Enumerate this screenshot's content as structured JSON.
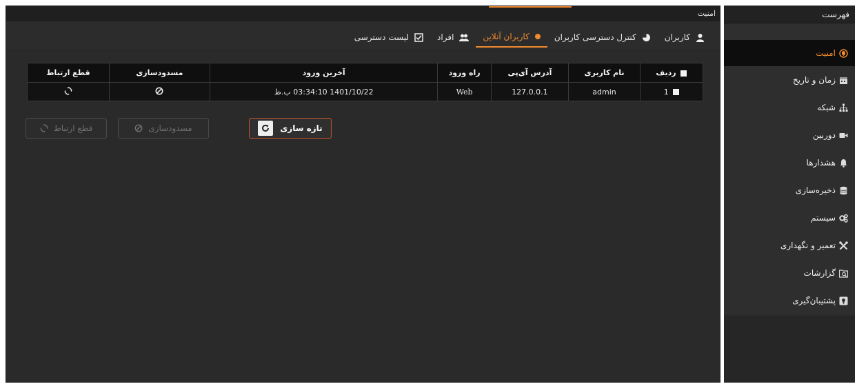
{
  "sidebar": {
    "title": "فهرست",
    "items": [
      {
        "label": "امنیت",
        "icon": "shield-icon",
        "active": true
      },
      {
        "label": "زمان و تاریخ",
        "icon": "calendar-icon"
      },
      {
        "label": "شبکه",
        "icon": "network-icon"
      },
      {
        "label": "دوربین",
        "icon": "camera-icon"
      },
      {
        "label": "هشدارها",
        "icon": "bell-icon"
      },
      {
        "label": "ذخیره‌سازی",
        "icon": "database-icon"
      },
      {
        "label": "سیستم",
        "icon": "gears-icon"
      },
      {
        "label": "تعمیر و نگهداری",
        "icon": "tools-icon"
      },
      {
        "label": "گزارشات",
        "icon": "report-search-icon"
      },
      {
        "label": "پشتیبان‌گیری",
        "icon": "backup-icon"
      }
    ]
  },
  "main": {
    "title": "امنیت",
    "tabs": [
      {
        "label": "کاربران",
        "icon": "user-icon"
      },
      {
        "label": "کنترل دسترسی کاربران",
        "icon": "pie-icon"
      },
      {
        "label": "کاربران آنلاین",
        "icon": "dot-icon",
        "active": true
      },
      {
        "label": "افراد",
        "icon": "people-icon"
      },
      {
        "label": "لیست دسترسی",
        "icon": "checklist-icon"
      }
    ]
  },
  "table": {
    "headers": {
      "row": "ردیف",
      "username": "نام کاربری",
      "ip": "آدرس آی‌پی",
      "via": "راه ورود",
      "last_login": "آخرین ورود",
      "block": "مسدودسازی",
      "disconnect": "قطع ارتباط"
    },
    "rows": [
      {
        "row": "1",
        "username": "admin",
        "ip": "127.0.0.1",
        "via": "Web",
        "last_login": "1401/10/22 03:34:10 ب.ظ"
      }
    ]
  },
  "actions": {
    "refresh_label": "تازه سازی",
    "block_label": "مسدودسازی",
    "disconnect_label": "قطع ارتباط"
  },
  "colors": {
    "accent": "#f08a2c",
    "button_border": "#c4542e",
    "panel_bg": "#2a2a2a",
    "table_bg": "#121212"
  }
}
